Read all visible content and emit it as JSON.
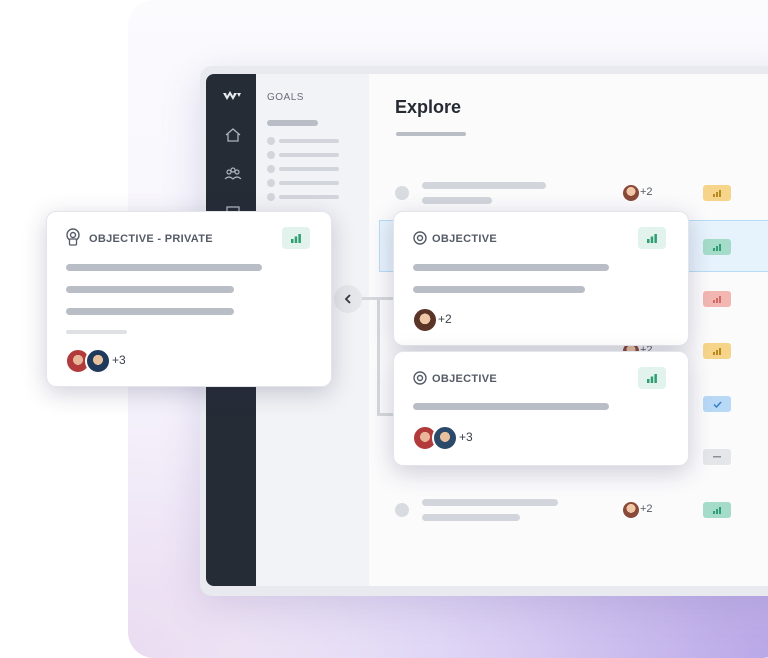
{
  "goals_panel": {
    "title": "GOALS"
  },
  "main": {
    "title": "Explore"
  },
  "list_rows": [
    {
      "extra_count": "+2",
      "status": "bar-chart",
      "status_color": "#f6d58a"
    },
    {
      "extra_count": "",
      "status": "bar-chart",
      "status_color": "#a5dcc9"
    },
    {
      "extra_count": "",
      "status": "bar-chart",
      "status_color": "#f3b7b3"
    },
    {
      "extra_count": "+2",
      "status": "bar-chart",
      "status_color": "#f6d58a"
    },
    {
      "extra_count": "",
      "status": "check",
      "status_color": "#b8d9f6"
    },
    {
      "extra_count": "",
      "status": "dash",
      "status_color": "#e4e6ea"
    },
    {
      "extra_count": "+2",
      "status": "bar-chart",
      "status_color": "#a5dcc9"
    }
  ],
  "cards": {
    "private": {
      "label": "OBJECTIVE - PRIVATE",
      "extra_count": "+3"
    },
    "first": {
      "label": "OBJECTIVE",
      "extra_count": "+2"
    },
    "second": {
      "label": "OBJECTIVE",
      "extra_count": "+3"
    }
  },
  "icons": {
    "logo": "wing-logo-icon",
    "nav": [
      "home-icon",
      "team-icon",
      "board-icon"
    ],
    "objective": "target-icon",
    "private_objective": "locked-target-icon",
    "collapse": "chevron-left-icon",
    "status": "bar-chart-icon"
  },
  "colors": {
    "sidebar": "#262c36",
    "accent_green": "#2f9e73",
    "highlight_row": "#e6f2fc"
  }
}
